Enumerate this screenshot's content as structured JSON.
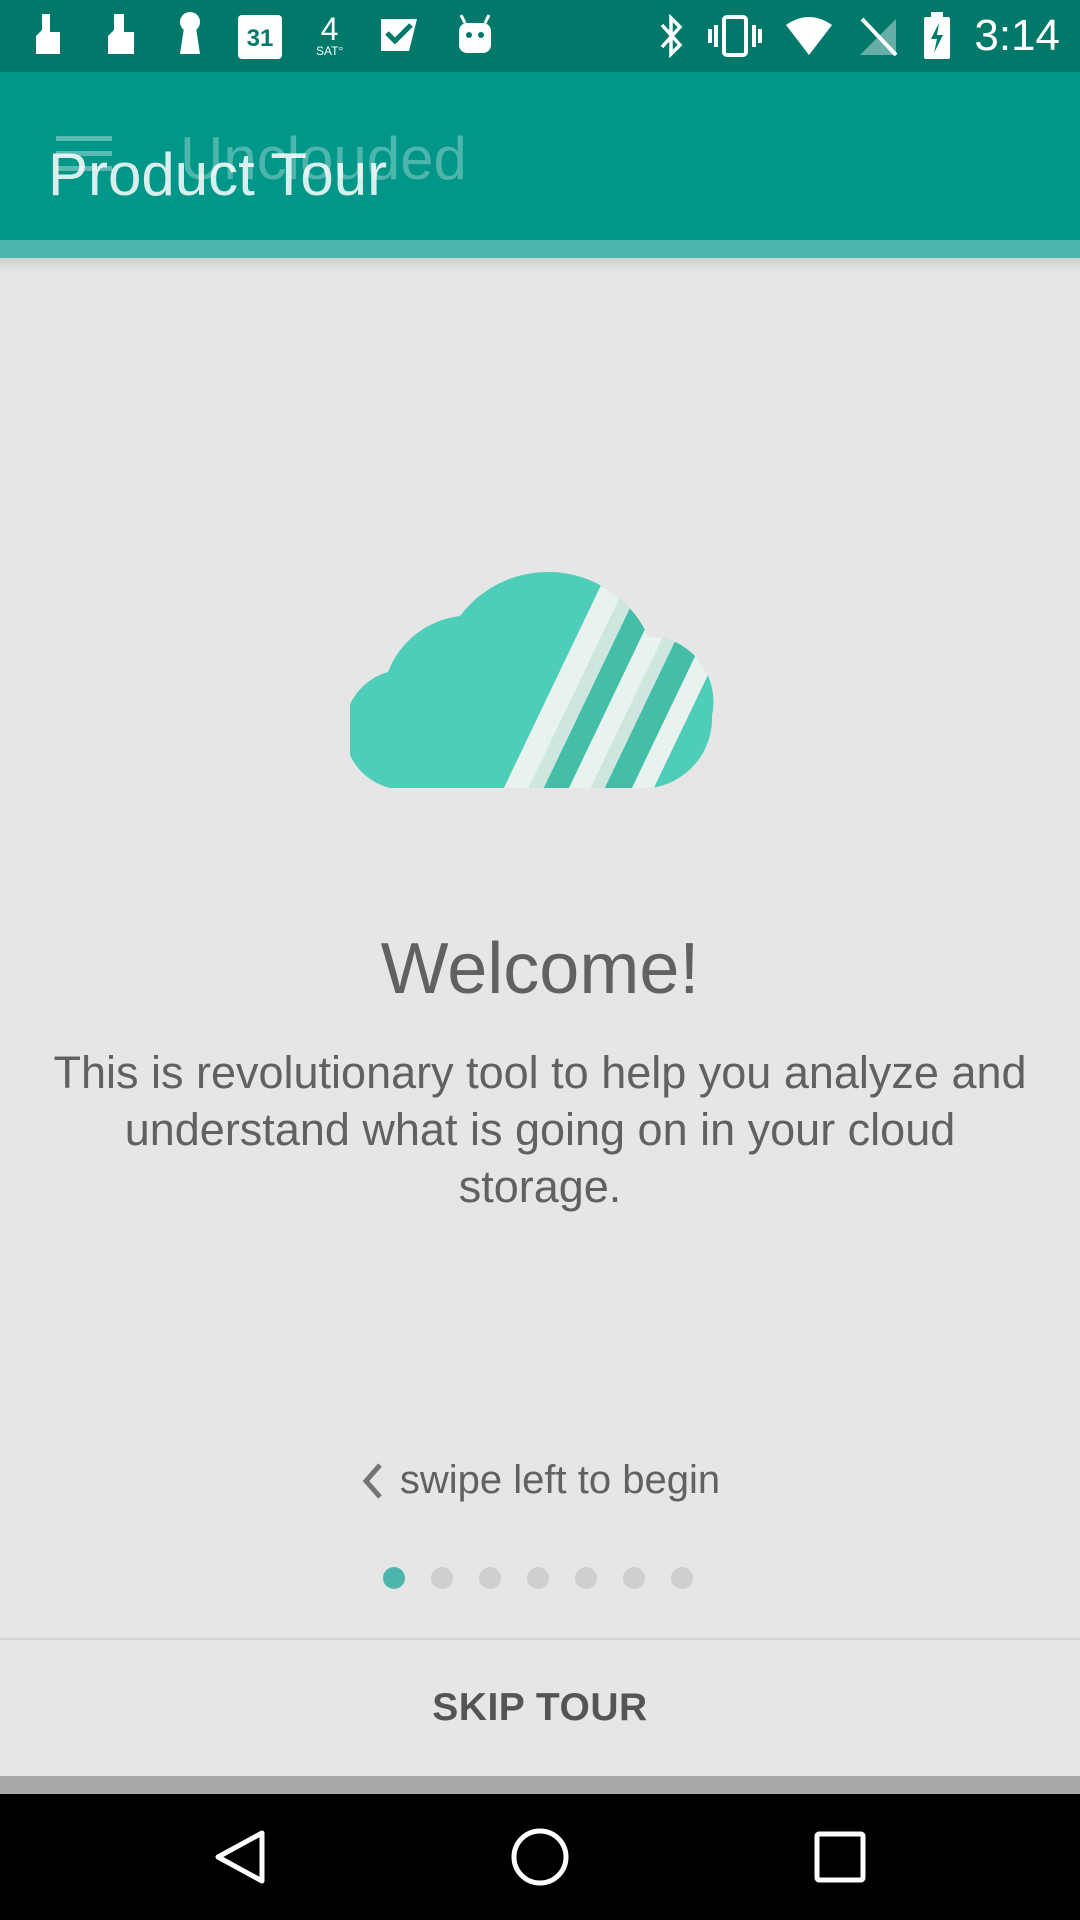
{
  "status_bar": {
    "time": "3:14",
    "left_icons": [
      "hand-pointer-icon",
      "hand-pointer-alt-icon",
      "keyhole-icon",
      "calendar-icon",
      "weather-icon",
      "inbox-check-icon",
      "android-icon"
    ],
    "calendar_day": "31",
    "weather_value": "4",
    "weather_day": "SAT°",
    "right_icons": [
      "bluetooth-icon",
      "vibrate-icon",
      "wifi-icon",
      "no-signal-icon",
      "battery-charging-icon"
    ]
  },
  "app_bar": {
    "title": "Product Tour",
    "background_app_title": "Unclouded",
    "color": "#009688"
  },
  "tour": {
    "heading": "Welcome!",
    "description": "This is revolutionary tool to help you analyze and understand what is going on in your cloud storage.",
    "swipe_hint": "swipe left to begin",
    "page_count": 7,
    "current_page": 1,
    "skip_label": "SKIP TOUR"
  },
  "colors": {
    "accent": "#4db6ac",
    "logo": "#4ecdb8",
    "status_bar": "#00796b"
  },
  "nav_bar": {
    "icons": [
      "back-icon",
      "home-icon",
      "recents-icon"
    ]
  }
}
